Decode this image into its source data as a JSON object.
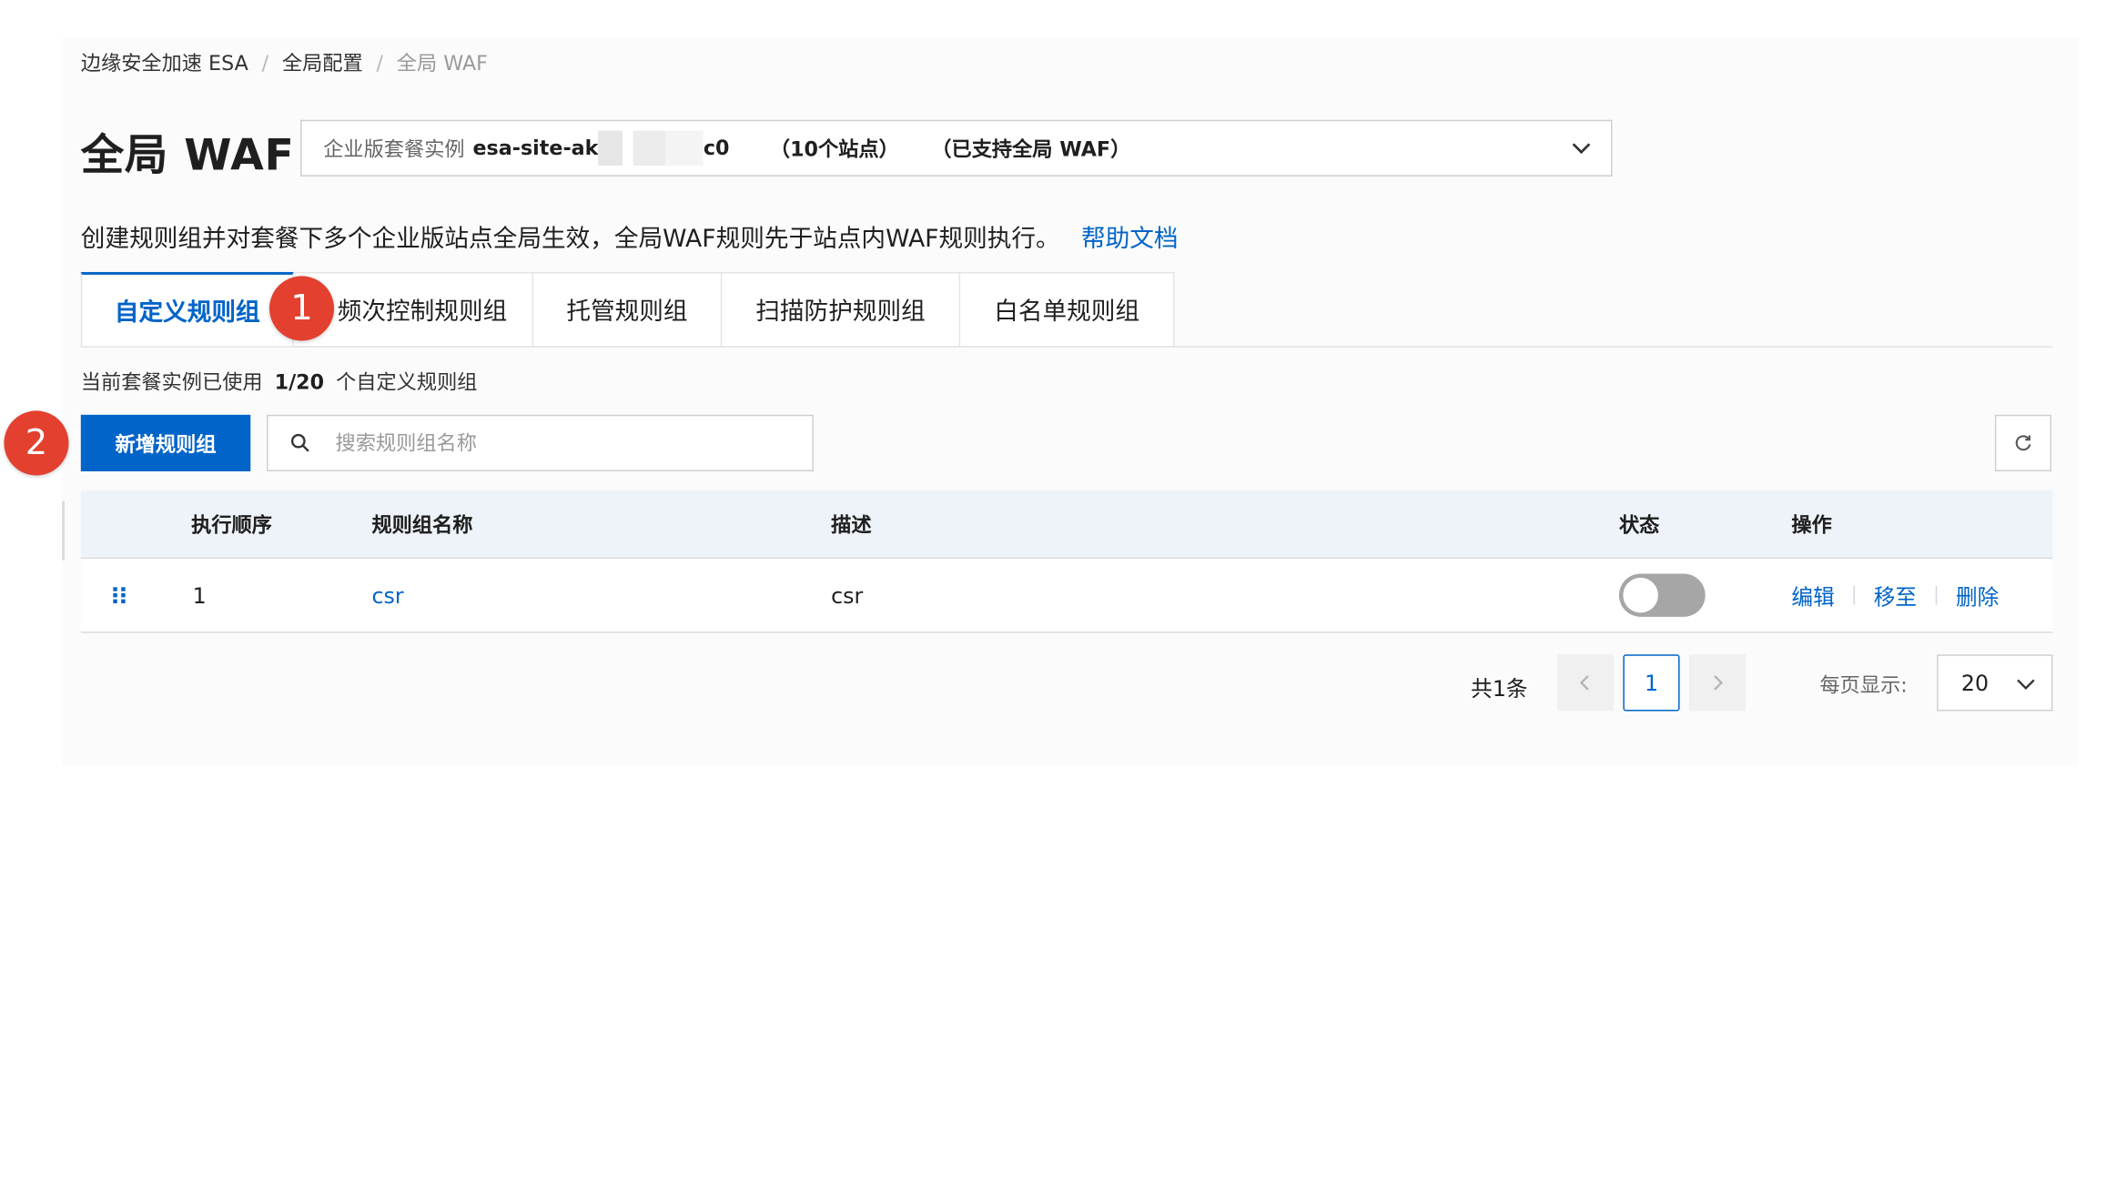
{
  "breadcrumb": {
    "items": [
      "边缘安全加速 ESA",
      "全局配置",
      "全局 WAF"
    ],
    "separator": "/"
  },
  "page": {
    "title": "全局 WAF",
    "description": "创建规则组并对套餐下多个企业版站点全局生效，全局WAF规则先于站点内WAF规则执行。",
    "help_link": "帮助文档"
  },
  "instance_select": {
    "label": "企业版套餐实例",
    "name_prefix": "esa-site-ak",
    "name_suffix": "c0",
    "sites": "（10个站点）",
    "support": "（已支持全局 WAF）"
  },
  "tabs": [
    {
      "label": "自定义规则组",
      "active": true
    },
    {
      "label": "频次控制规则组",
      "active": false
    },
    {
      "label": "托管规则组",
      "active": false
    },
    {
      "label": "扫描防护规则组",
      "active": false
    },
    {
      "label": "白名单规则组",
      "active": false
    }
  ],
  "badges": [
    "1",
    "2"
  ],
  "usage": {
    "prefix": "当前套餐实例已使用",
    "count": "1/20",
    "suffix": "个自定义规则组"
  },
  "toolbar": {
    "add_label": "新增规则组",
    "search_placeholder": "搜索规则组名称"
  },
  "table": {
    "columns": [
      "执行顺序",
      "规则组名称",
      "描述",
      "状态",
      "操作"
    ],
    "rows": [
      {
        "order": "1",
        "name": "csr",
        "description": "csr",
        "enabled": false,
        "actions": [
          "编辑",
          "移至",
          "删除"
        ]
      }
    ]
  },
  "pagination": {
    "total": "共1条",
    "current_page": "1",
    "per_page_label": "每页显示:",
    "per_page": "20"
  },
  "colors": {
    "accent": "#0064c8",
    "badge": "#e3402f",
    "toggle_off": "#a6a6a6",
    "table_header_bg": "#eef3f9"
  },
  "icons": [
    "chevron-down-icon",
    "search-icon",
    "refresh-icon",
    "drag-handle-icon",
    "chevron-left-icon",
    "chevron-right-icon"
  ]
}
